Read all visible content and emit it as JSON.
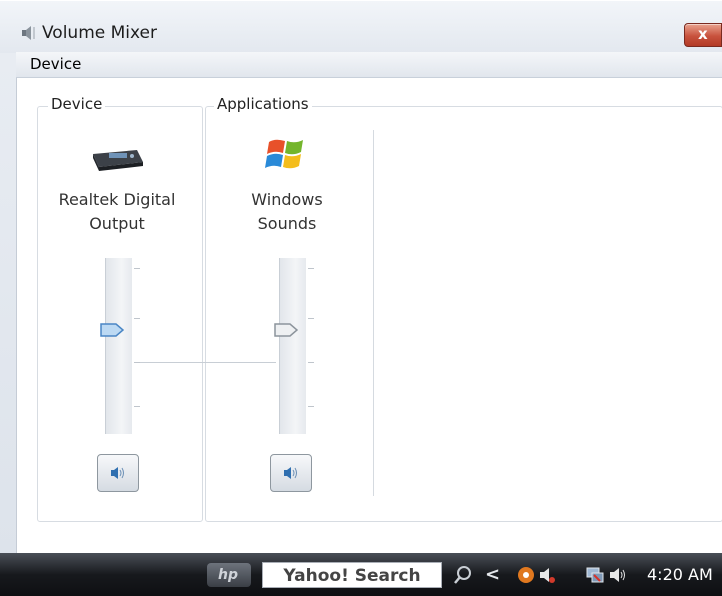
{
  "window": {
    "title": "Volume Mixer",
    "close_label": "x"
  },
  "menu": {
    "items": [
      "Device"
    ]
  },
  "groups": {
    "device_label": "Device",
    "applications_label": "Applications"
  },
  "device_column": {
    "name_line1": "Realtek Digital",
    "name_line2": "Output",
    "volume_fraction": 0.6,
    "icon": "speaker-device-icon",
    "mute_icon": "speaker-icon"
  },
  "app_column": {
    "name_line1": "Windows",
    "name_line2": "Sounds",
    "volume_fraction": 0.6,
    "icon": "windows-logo-icon",
    "mute_icon": "speaker-icon"
  },
  "taskbar": {
    "logo_text": "hp",
    "search_text": "Yahoo! Search",
    "chevron": "<",
    "clock": "4:20 AM"
  }
}
